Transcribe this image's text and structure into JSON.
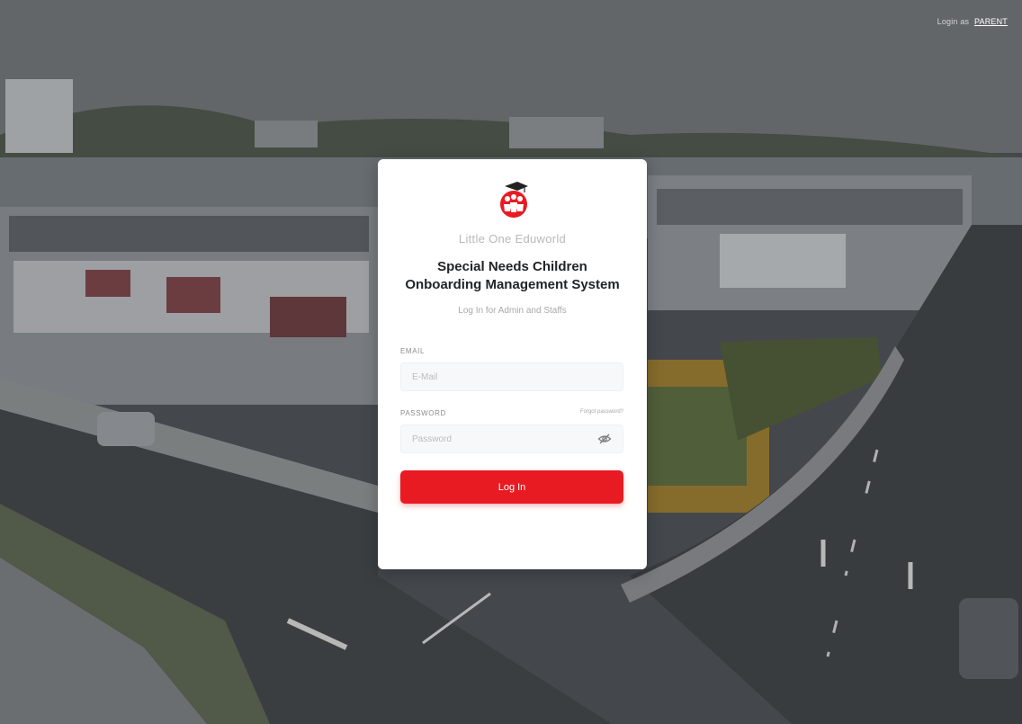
{
  "header": {
    "login_prefix": "Login as",
    "login_link": "PARENT"
  },
  "card": {
    "logo_icon": "little-one-logo-icon",
    "brand_name": "Little One Eduworld",
    "title_line1": "Special Needs Children",
    "title_line2": "Onboarding Management System",
    "subtitle": "Log In for Admin and Staffs",
    "email": {
      "label": "EMAIL",
      "placeholder": "E-Mail",
      "value": ""
    },
    "password": {
      "label": "PASSWORD",
      "placeholder": "Password",
      "value": "",
      "forgot_link": "Forgot password?",
      "toggle_icon": "eye-off-icon"
    },
    "login_button": "Log In"
  },
  "colors": {
    "accent": "#e81b23",
    "card_bg": "#ffffff",
    "title": "#222428"
  }
}
